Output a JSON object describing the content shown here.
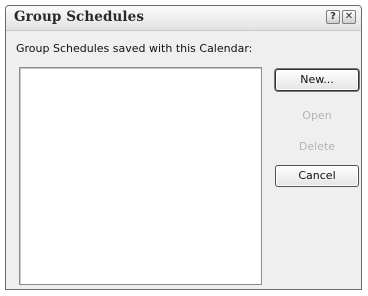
{
  "window": {
    "title": "Group Schedules",
    "help_glyph": "?",
    "close_glyph": "✕"
  },
  "list": {
    "label": "Group Schedules saved with this Calendar:",
    "items": []
  },
  "buttons": {
    "new_label": "New...",
    "open_label": "Open",
    "delete_label": "Delete",
    "cancel_label": "Cancel"
  }
}
